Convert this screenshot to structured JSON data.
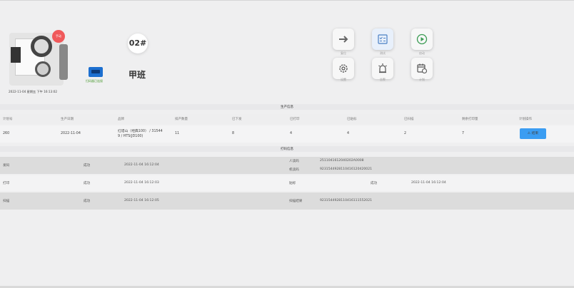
{
  "machine": {
    "badge": "手动",
    "datetime": "2022-11-04 星期五 下午 16:13:02"
  },
  "scanner": {
    "label": "扫码器已连接"
  },
  "line": {
    "number": "02#",
    "shift": "甲班"
  },
  "actions": [
    {
      "label": "复位",
      "icon": "arrow-right-icon"
    },
    {
      "label": "测试",
      "icon": "checklist-icon"
    },
    {
      "label": "启动",
      "icon": "play-icon"
    },
    {
      "label": "设置",
      "icon": "gear-icon"
    },
    {
      "label": "告警",
      "icon": "alarm-icon"
    },
    {
      "label": "计划",
      "icon": "calendar-icon"
    }
  ],
  "plan": {
    "title": "生产信息",
    "columns": [
      "计划号",
      "生产日期",
      "品牌",
      "排产数量",
      "已下发",
      "已打印",
      "已贴标",
      "已扫描",
      "剩余打印量",
      "计划操作"
    ],
    "row": {
      "plan_no": "260",
      "date": "2022-11-04",
      "brand_line1": "红塔山（经典100） / 31544",
      "brand_line2": "9 / HTS(JD100)",
      "quantity": "11",
      "issued": "8",
      "printed": "4",
      "labeled": "4",
      "scanned": "2",
      "remaining": "7",
      "action": "结束"
    }
  },
  "print_info": {
    "title": "打码信息",
    "rows": [
      {
        "name": "发码",
        "status": "成功",
        "time": "2022-11-04 16:12:04",
        "key1": "人读码",
        "val1": "2511041612040202A0008",
        "key2": "机读码",
        "val2": "9231544928110416120420021"
      },
      {
        "name": "打印",
        "status": "成功",
        "time": "2022-11-04 16:12:03",
        "key1": "贴标",
        "status2": "成功",
        "time2": "2022-11-04 16:12:04"
      },
      {
        "name": "扫描",
        "status": "成功",
        "time": "2022-11-04 16:12:05",
        "key1": "扫描结果",
        "val1": "9231544928110416111552021"
      }
    ]
  },
  "colors": {
    "accent": "#3b9df2",
    "alarm_badge": "#f0595b",
    "scanner": "#1c6fd0"
  }
}
